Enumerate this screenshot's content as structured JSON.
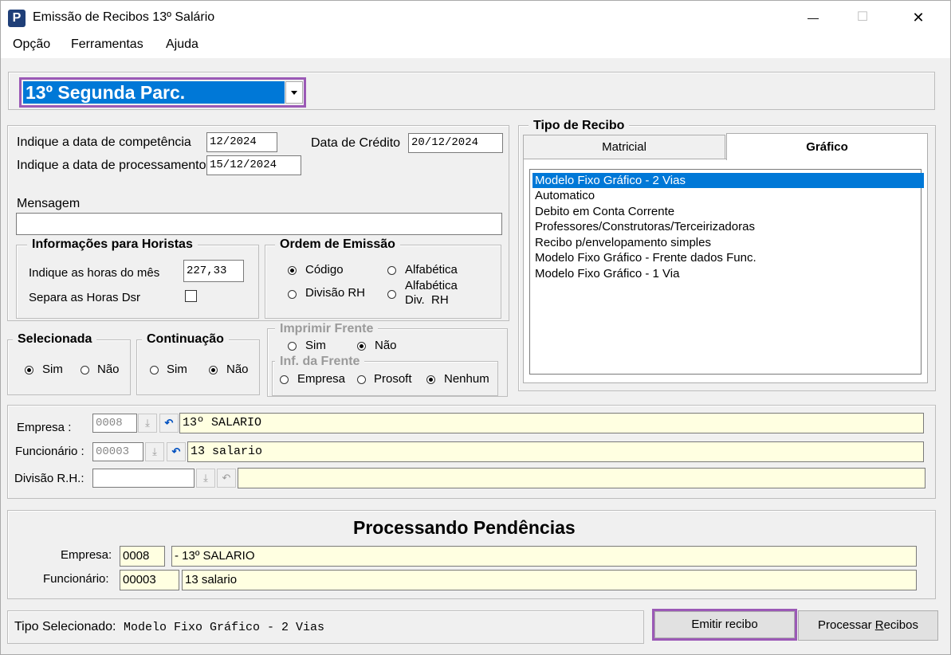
{
  "window": {
    "title": "Emissão de Recibos 13º Salário",
    "app_icon_letter": "P",
    "controls": {
      "minimize": "—",
      "maximize": "☐",
      "close": "✕"
    }
  },
  "menu": [
    "Opção",
    "Ferramentas",
    "Ajuda"
  ],
  "parcel_select": {
    "value": "13º Segunda Parc.",
    "accent": "#0078d7",
    "highlight": "#9b59b6"
  },
  "dates": {
    "competencia_label": "Indique a data de competência",
    "competencia_value": "12/2024",
    "credito_label": "Data de Crédito",
    "credito_value": "20/12/2024",
    "processamento_label": "Indique a data de processamento",
    "processamento_value": "15/12/2024"
  },
  "mensagem": {
    "label": "Mensagem",
    "value": ""
  },
  "horistas": {
    "title": "Informações para Horistas",
    "horas_label": "Indique as horas do mês",
    "horas_value": "227,33",
    "separa_label": "Separa as Horas Dsr",
    "separa_checked": false
  },
  "ordem": {
    "title": "Ordem de Emissão",
    "codigo": "Código",
    "alfabetica": "Alfabética",
    "divisao": "Divisão RH",
    "alfa_div_1": "Alfabética",
    "alfa_div_2": "Div.  RH",
    "selected": "codigo"
  },
  "selecionada": {
    "title": "Selecionada",
    "sim": "Sim",
    "nao": "Não",
    "selected": "sim"
  },
  "continuacao": {
    "title": "Continuação",
    "sim": "Sim",
    "nao": "Não",
    "selected": "nao"
  },
  "imprimir": {
    "title": "Imprimir Frente",
    "sim": "Sim",
    "nao": "Não",
    "selected": "nao",
    "inf_title": "Inf. da Frente",
    "empresa": "Empresa",
    "prosoft": "Prosoft",
    "nenhum": "Nenhum",
    "inf_selected": "nenhum"
  },
  "tipo_recibo": {
    "title": "Tipo de Recibo",
    "tabs": [
      "Matricial",
      "Gráfico"
    ],
    "active_tab": "Gráfico",
    "items": [
      "Modelo Fixo Gráfico - 2 Vias",
      "Automatico",
      "Debito em Conta Corrente",
      "Professores/Construtoras/Terceirizadoras",
      "Recibo p/envelopamento simples",
      "Modelo Fixo Gráfico - Frente dados Func.",
      "Modelo Fixo Gráfico - 1 Via"
    ],
    "selected_index": 0
  },
  "filtros": {
    "empresa_label": "Empresa :",
    "empresa_code": "0008",
    "empresa_name": "13º SALARIO",
    "funcionario_label": "Funcionário :",
    "funcionario_code": "00003",
    "funcionario_name": "13 salario",
    "divisao_label": "Divisão R.H.:",
    "divisao_code": "",
    "divisao_name": ""
  },
  "pendencias": {
    "title": "Processando Pendências",
    "empresa_label": "Empresa:",
    "empresa_code": "0008",
    "empresa_name": "- 13º SALARIO",
    "funcionario_label": "Funcionário:",
    "funcionario_code": "00003",
    "funcionario_name": "13 salario"
  },
  "status": {
    "label": "Tipo Selecionado:",
    "value": "Modelo Fixo Gráfico - 2 Vias"
  },
  "buttons": {
    "emitir": "Emitir recibo",
    "processar_prefix": "Processar ",
    "processar_mnemonic": "R",
    "processar_suffix": "ecibos"
  }
}
